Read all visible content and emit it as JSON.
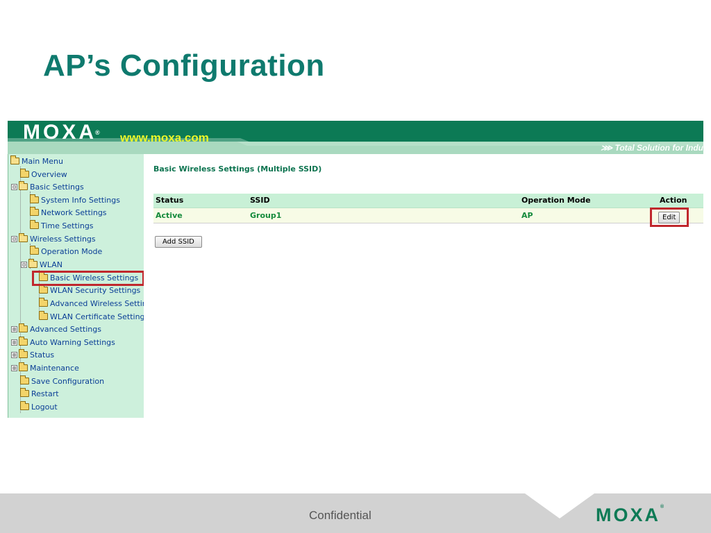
{
  "slide": {
    "title": "AP’s Configuration"
  },
  "header": {
    "logo": "MOXA",
    "logo_reg": "®",
    "url": "www.moxa.com",
    "slogan": "⋙ Total Solution for Indu"
  },
  "sidebar": {
    "items": [
      {
        "label": "Main Menu",
        "expander": ""
      },
      {
        "label": "Overview",
        "expander": ""
      },
      {
        "label": "Basic Settings",
        "expander": "⊟"
      },
      {
        "label": "System Info Settings",
        "expander": ""
      },
      {
        "label": "Network Settings",
        "expander": ""
      },
      {
        "label": "Time Settings",
        "expander": ""
      },
      {
        "label": "Wireless Settings",
        "expander": "⊟"
      },
      {
        "label": "Operation Mode",
        "expander": ""
      },
      {
        "label": "WLAN",
        "expander": "⊟"
      },
      {
        "label": "Basic Wireless Settings",
        "expander": ""
      },
      {
        "label": "WLAN Security Settings",
        "expander": ""
      },
      {
        "label": "Advanced Wireless Settir",
        "expander": ""
      },
      {
        "label": "WLAN Certificate Settings",
        "expander": ""
      },
      {
        "label": "Advanced Settings",
        "expander": "⊞"
      },
      {
        "label": "Auto Warning Settings",
        "expander": "⊞"
      },
      {
        "label": "Status",
        "expander": "⊞"
      },
      {
        "label": "Maintenance",
        "expander": "⊞"
      },
      {
        "label": "Save Configuration",
        "expander": ""
      },
      {
        "label": "Restart",
        "expander": ""
      },
      {
        "label": "Logout",
        "expander": ""
      }
    ],
    "selected": "Basic Wireless Settings"
  },
  "main": {
    "section_title": "Basic Wireless Settings (Multiple SSID)",
    "table": {
      "headers": [
        "Status",
        "SSID",
        "Operation Mode",
        "Action"
      ],
      "rows": [
        {
          "status": "Active",
          "ssid": "Group1",
          "mode": "AP",
          "action": "Edit"
        }
      ]
    },
    "add_button": "Add SSID"
  },
  "footer": {
    "text": "Confidential",
    "logo": "MOXA",
    "logo_reg": "®"
  },
  "colors": {
    "title": "#0f7a6e",
    "header_dark": "#0c7a55",
    "header_light": "#a9d9bf",
    "sidebar_bg": "#cdf0dc",
    "sidebar_text": "#0a3e96",
    "highlight_border": "#c0282d",
    "table_header_bg": "#c8f0d6",
    "table_row_bg": "#f7fbe6",
    "table_row_text": "#148a3c",
    "footer_bg": "#d2d2d2",
    "url": "#e9f52a"
  }
}
